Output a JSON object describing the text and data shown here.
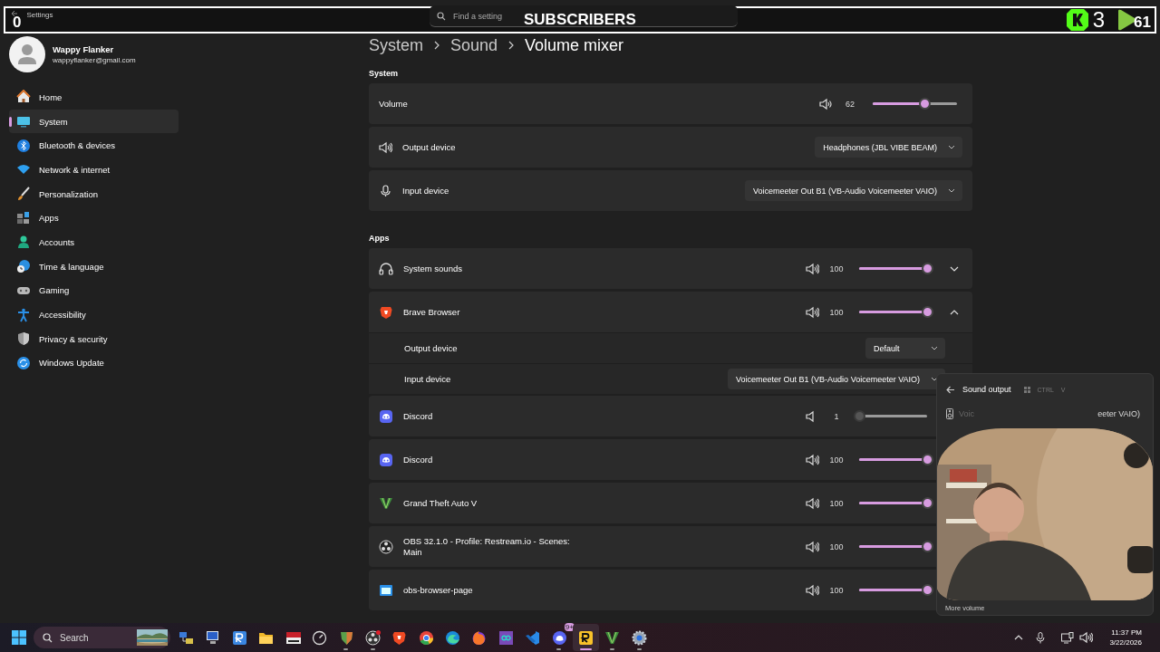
{
  "overlay": {
    "subscriber_count": "0",
    "label": "SUBSCRIBERS",
    "kick_count": "3",
    "rumble_count": "61"
  },
  "window": {
    "title": "Settings",
    "search": {
      "placeholder": "Find a setting"
    }
  },
  "account": {
    "name": "Wappy Flanker",
    "email": "wappyflanker@gmail.com"
  },
  "sidebar": {
    "items": [
      {
        "label": "Home",
        "selected": false
      },
      {
        "label": "System",
        "selected": true
      },
      {
        "label": "Bluetooth & devices",
        "selected": false
      },
      {
        "label": "Network & internet",
        "selected": false
      },
      {
        "label": "Personalization",
        "selected": false
      },
      {
        "label": "Apps",
        "selected": false
      },
      {
        "label": "Accounts",
        "selected": false
      },
      {
        "label": "Time & language",
        "selected": false
      },
      {
        "label": "Gaming",
        "selected": false
      },
      {
        "label": "Accessibility",
        "selected": false
      },
      {
        "label": "Privacy & security",
        "selected": false
      },
      {
        "label": "Windows Update",
        "selected": false
      }
    ]
  },
  "breadcrumb": [
    "System",
    "Sound",
    "Volume mixer"
  ],
  "system": {
    "heading": "System",
    "rows": [
      {
        "kind": "slider",
        "label": "Volume",
        "reading": "62",
        "level": 0.62
      },
      {
        "kind": "dropdown",
        "label": "Output device",
        "value": "Headphones (JBL VIBE BEAM)"
      },
      {
        "kind": "dropdown",
        "label": "Input device",
        "value": "Voicemeeter Out B1 (VB-Audio Voicemeeter VAIO)"
      }
    ]
  },
  "apps": {
    "heading": "Apps",
    "rows": [
      {
        "name": "System sounds",
        "reading": "100",
        "level": 1,
        "expanded": false
      },
      {
        "name": "Brave Browser",
        "reading": "100",
        "level": 1,
        "expanded": true,
        "children": [
          {
            "label": "Output device",
            "value": "Default"
          },
          {
            "label": "Input device",
            "value": "Voicemeeter Out B1 (VB-Audio Voicemeeter VAIO)"
          }
        ]
      },
      {
        "name": "Discord",
        "reading": "1",
        "level": 0.01
      },
      {
        "name": "Discord",
        "reading": "100",
        "level": 1
      },
      {
        "name": "Grand Theft Auto V",
        "reading": "100",
        "level": 1
      },
      {
        "name": "OBS 32.1.0 - Profile: Restream.io - Scenes: Main",
        "reading": "100",
        "level": 1
      },
      {
        "name": "obs-browser-page",
        "reading": "100",
        "level": 1
      }
    ]
  },
  "flyout": {
    "title": "Sound output",
    "shortcut": [
      "CTRL",
      "V"
    ],
    "device_start": "Voic",
    "device_end": "eeter VAIO)",
    "footer": "More volume"
  },
  "taskbar": {
    "search": {
      "placeholder": "Search"
    },
    "apps": [
      {
        "running": false,
        "selected": false
      },
      {
        "running": false,
        "selected": false
      },
      {
        "running": false,
        "selected": false
      },
      {
        "running": false,
        "selected": false
      },
      {
        "running": false,
        "selected": false
      },
      {
        "running": false,
        "selected": false
      },
      {
        "running": true,
        "selected": false
      },
      {
        "running": true,
        "selected": false
      },
      {
        "running": false,
        "selected": false
      },
      {
        "running": false,
        "selected": false
      },
      {
        "running": false,
        "selected": false
      },
      {
        "running": false,
        "selected": false
      },
      {
        "running": false,
        "selected": false
      },
      {
        "running": false,
        "selected": false
      },
      {
        "running": true,
        "selected": false,
        "badge": "9+"
      },
      {
        "running": true,
        "selected": true
      },
      {
        "running": true,
        "selected": false
      },
      {
        "running": true,
        "selected": false
      }
    ],
    "time": "11:37 PM",
    "date": "3/22/2026"
  }
}
